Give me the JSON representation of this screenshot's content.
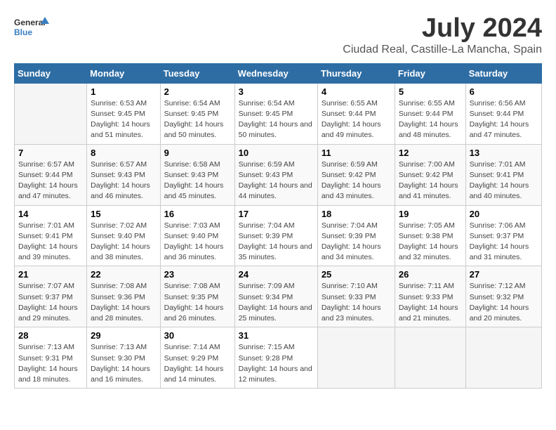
{
  "logo": {
    "general": "General",
    "blue": "Blue"
  },
  "title": "July 2024",
  "subtitle": "Ciudad Real, Castille-La Mancha, Spain",
  "weekdays": [
    "Sunday",
    "Monday",
    "Tuesday",
    "Wednesday",
    "Thursday",
    "Friday",
    "Saturday"
  ],
  "weeks": [
    [
      {
        "day": "",
        "sunrise": "",
        "sunset": "",
        "daylight": ""
      },
      {
        "day": "1",
        "sunrise": "Sunrise: 6:53 AM",
        "sunset": "Sunset: 9:45 PM",
        "daylight": "Daylight: 14 hours and 51 minutes."
      },
      {
        "day": "2",
        "sunrise": "Sunrise: 6:54 AM",
        "sunset": "Sunset: 9:45 PM",
        "daylight": "Daylight: 14 hours and 50 minutes."
      },
      {
        "day": "3",
        "sunrise": "Sunrise: 6:54 AM",
        "sunset": "Sunset: 9:45 PM",
        "daylight": "Daylight: 14 hours and 50 minutes."
      },
      {
        "day": "4",
        "sunrise": "Sunrise: 6:55 AM",
        "sunset": "Sunset: 9:44 PM",
        "daylight": "Daylight: 14 hours and 49 minutes."
      },
      {
        "day": "5",
        "sunrise": "Sunrise: 6:55 AM",
        "sunset": "Sunset: 9:44 PM",
        "daylight": "Daylight: 14 hours and 48 minutes."
      },
      {
        "day": "6",
        "sunrise": "Sunrise: 6:56 AM",
        "sunset": "Sunset: 9:44 PM",
        "daylight": "Daylight: 14 hours and 47 minutes."
      }
    ],
    [
      {
        "day": "7",
        "sunrise": "Sunrise: 6:57 AM",
        "sunset": "Sunset: 9:44 PM",
        "daylight": "Daylight: 14 hours and 47 minutes."
      },
      {
        "day": "8",
        "sunrise": "Sunrise: 6:57 AM",
        "sunset": "Sunset: 9:43 PM",
        "daylight": "Daylight: 14 hours and 46 minutes."
      },
      {
        "day": "9",
        "sunrise": "Sunrise: 6:58 AM",
        "sunset": "Sunset: 9:43 PM",
        "daylight": "Daylight: 14 hours and 45 minutes."
      },
      {
        "day": "10",
        "sunrise": "Sunrise: 6:59 AM",
        "sunset": "Sunset: 9:43 PM",
        "daylight": "Daylight: 14 hours and 44 minutes."
      },
      {
        "day": "11",
        "sunrise": "Sunrise: 6:59 AM",
        "sunset": "Sunset: 9:42 PM",
        "daylight": "Daylight: 14 hours and 43 minutes."
      },
      {
        "day": "12",
        "sunrise": "Sunrise: 7:00 AM",
        "sunset": "Sunset: 9:42 PM",
        "daylight": "Daylight: 14 hours and 41 minutes."
      },
      {
        "day": "13",
        "sunrise": "Sunrise: 7:01 AM",
        "sunset": "Sunset: 9:41 PM",
        "daylight": "Daylight: 14 hours and 40 minutes."
      }
    ],
    [
      {
        "day": "14",
        "sunrise": "Sunrise: 7:01 AM",
        "sunset": "Sunset: 9:41 PM",
        "daylight": "Daylight: 14 hours and 39 minutes."
      },
      {
        "day": "15",
        "sunrise": "Sunrise: 7:02 AM",
        "sunset": "Sunset: 9:40 PM",
        "daylight": "Daylight: 14 hours and 38 minutes."
      },
      {
        "day": "16",
        "sunrise": "Sunrise: 7:03 AM",
        "sunset": "Sunset: 9:40 PM",
        "daylight": "Daylight: 14 hours and 36 minutes."
      },
      {
        "day": "17",
        "sunrise": "Sunrise: 7:04 AM",
        "sunset": "Sunset: 9:39 PM",
        "daylight": "Daylight: 14 hours and 35 minutes."
      },
      {
        "day": "18",
        "sunrise": "Sunrise: 7:04 AM",
        "sunset": "Sunset: 9:39 PM",
        "daylight": "Daylight: 14 hours and 34 minutes."
      },
      {
        "day": "19",
        "sunrise": "Sunrise: 7:05 AM",
        "sunset": "Sunset: 9:38 PM",
        "daylight": "Daylight: 14 hours and 32 minutes."
      },
      {
        "day": "20",
        "sunrise": "Sunrise: 7:06 AM",
        "sunset": "Sunset: 9:37 PM",
        "daylight": "Daylight: 14 hours and 31 minutes."
      }
    ],
    [
      {
        "day": "21",
        "sunrise": "Sunrise: 7:07 AM",
        "sunset": "Sunset: 9:37 PM",
        "daylight": "Daylight: 14 hours and 29 minutes."
      },
      {
        "day": "22",
        "sunrise": "Sunrise: 7:08 AM",
        "sunset": "Sunset: 9:36 PM",
        "daylight": "Daylight: 14 hours and 28 minutes."
      },
      {
        "day": "23",
        "sunrise": "Sunrise: 7:08 AM",
        "sunset": "Sunset: 9:35 PM",
        "daylight": "Daylight: 14 hours and 26 minutes."
      },
      {
        "day": "24",
        "sunrise": "Sunrise: 7:09 AM",
        "sunset": "Sunset: 9:34 PM",
        "daylight": "Daylight: 14 hours and 25 minutes."
      },
      {
        "day": "25",
        "sunrise": "Sunrise: 7:10 AM",
        "sunset": "Sunset: 9:33 PM",
        "daylight": "Daylight: 14 hours and 23 minutes."
      },
      {
        "day": "26",
        "sunrise": "Sunrise: 7:11 AM",
        "sunset": "Sunset: 9:33 PM",
        "daylight": "Daylight: 14 hours and 21 minutes."
      },
      {
        "day": "27",
        "sunrise": "Sunrise: 7:12 AM",
        "sunset": "Sunset: 9:32 PM",
        "daylight": "Daylight: 14 hours and 20 minutes."
      }
    ],
    [
      {
        "day": "28",
        "sunrise": "Sunrise: 7:13 AM",
        "sunset": "Sunset: 9:31 PM",
        "daylight": "Daylight: 14 hours and 18 minutes."
      },
      {
        "day": "29",
        "sunrise": "Sunrise: 7:13 AM",
        "sunset": "Sunset: 9:30 PM",
        "daylight": "Daylight: 14 hours and 16 minutes."
      },
      {
        "day": "30",
        "sunrise": "Sunrise: 7:14 AM",
        "sunset": "Sunset: 9:29 PM",
        "daylight": "Daylight: 14 hours and 14 minutes."
      },
      {
        "day": "31",
        "sunrise": "Sunrise: 7:15 AM",
        "sunset": "Sunset: 9:28 PM",
        "daylight": "Daylight: 14 hours and 12 minutes."
      },
      {
        "day": "",
        "sunrise": "",
        "sunset": "",
        "daylight": ""
      },
      {
        "day": "",
        "sunrise": "",
        "sunset": "",
        "daylight": ""
      },
      {
        "day": "",
        "sunrise": "",
        "sunset": "",
        "daylight": ""
      }
    ]
  ]
}
